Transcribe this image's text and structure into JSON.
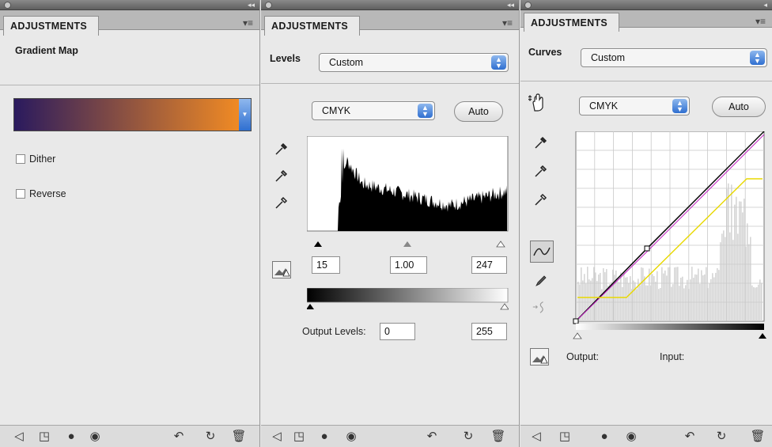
{
  "panels": [
    {
      "tab": "ADJUSTMENTS",
      "menu_icon": "▾≡",
      "title": "Gradient Map",
      "gradient": {
        "from": "#2a1a5e",
        "to": "#f08a24"
      },
      "dither_label": "Dither",
      "reverse_label": "Reverse"
    },
    {
      "tab": "ADJUSTMENTS",
      "menu_icon": "▾≡",
      "title": "Levels",
      "preset": "Custom",
      "channel": "CMYK",
      "auto_label": "Auto",
      "input_black": "15",
      "input_gamma": "1.00",
      "input_white": "247",
      "output_label": "Output Levels:",
      "output_black": "0",
      "output_white": "255"
    },
    {
      "tab": "ADJUSTMENTS",
      "menu_icon": "▾≡",
      "title": "Curves",
      "preset": "Custom",
      "channel": "CMYK",
      "auto_label": "Auto",
      "output_label": "Output:",
      "input_label": "Input:"
    }
  ],
  "bottom_icons": [
    "back-arrow-icon",
    "clip-to-layer-icon",
    "layer-mask-icon",
    "visibility-eye-icon",
    "view-previous-icon",
    "reset-icon",
    "trash-icon"
  ],
  "colors": {
    "accent_blue": "#2f6fd0",
    "curve_black": "#000000",
    "curve_magenta": "#c020c0",
    "curve_yellow": "#e8d800"
  }
}
